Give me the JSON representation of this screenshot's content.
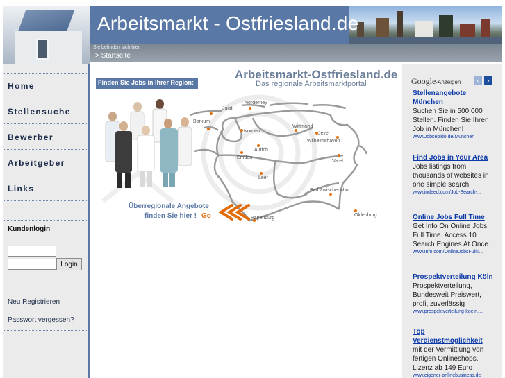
{
  "header": {
    "site_title": "Arbeitsmarkt - Ostfriesland.de",
    "breadcrumb_label": "Sie befinden sich hier:",
    "breadcrumb_current": "> Startseite"
  },
  "nav": {
    "items": [
      {
        "label": "Home"
      },
      {
        "label": "Stellensuche"
      },
      {
        "label": "Bewerber"
      },
      {
        "label": "Arbeitgeber"
      },
      {
        "label": "Links"
      }
    ]
  },
  "login": {
    "title": "Kundenlogin",
    "username_value": "",
    "password_value": "",
    "button_label": "Login",
    "register_link": "Neu Registrieren",
    "forgot_link": "Passwort vergessen?"
  },
  "main": {
    "brand": "Arbeitsmarkt-Ostfriesland.de",
    "tagline": "Das regionale Arbeitsmarktportal",
    "region_label": "Finden Sie Jobs in Ihrer Region:",
    "promo_line1": "Überregionale Angebote",
    "promo_line2": "finden Sie hier !",
    "promo_go": "Go",
    "cities": [
      {
        "name": "Juist"
      },
      {
        "name": "Norderney"
      },
      {
        "name": "Borkum"
      },
      {
        "name": "Norden"
      },
      {
        "name": "Wittmund"
      },
      {
        "name": "Jever"
      },
      {
        "name": "Wilhelmshaven"
      },
      {
        "name": "Aurich"
      },
      {
        "name": "Emden"
      },
      {
        "name": "Varel"
      },
      {
        "name": "Leer"
      },
      {
        "name": "Bad Zwischenahn"
      },
      {
        "name": "Papenburg"
      },
      {
        "name": "Oldenburg"
      }
    ]
  },
  "ads": {
    "brand_google": "Google",
    "brand_suffix": "-Anzeigen",
    "prev_icon": "‹",
    "next_icon": "›",
    "items": [
      {
        "title": "Stellenangebote München",
        "body": "Suchen Sie in 500.000 Stellen. Finden Sie Ihren Job in München!",
        "url": "www.Jobsepido.de/Munchen"
      },
      {
        "title": "Find Jobs in Your Area",
        "body": "Jobs listings from thousands of websites in one simple search.",
        "url": "www.indeed.com/Job-Search-..."
      },
      {
        "title": "Online Jobs Full Time",
        "body": "Get Info On Online Jobs Full Time. Access 10 Search Engines At Once.",
        "url": "www.Info.com/OnlineJobsFullT..."
      },
      {
        "title": "Prospektverteilung Köln",
        "body": "Prospektverteilung, Bundesweit Preiswert, profi, zuverlässig",
        "url": "www.prospektverteilung-koeln...."
      },
      {
        "title": "Top Verdienstmöglichkeit",
        "body": "mit der Vermittlung von fertigen Onlineshops. Lizenz ab 149 Euro",
        "url": "www.eigener-onlinebusiness.de"
      }
    ]
  },
  "colors": {
    "brand_blue": "#5a78a6",
    "nav_bg": "#ebebeb",
    "accent_orange": "#e36c0a",
    "ad_link": "#0b39a8"
  }
}
